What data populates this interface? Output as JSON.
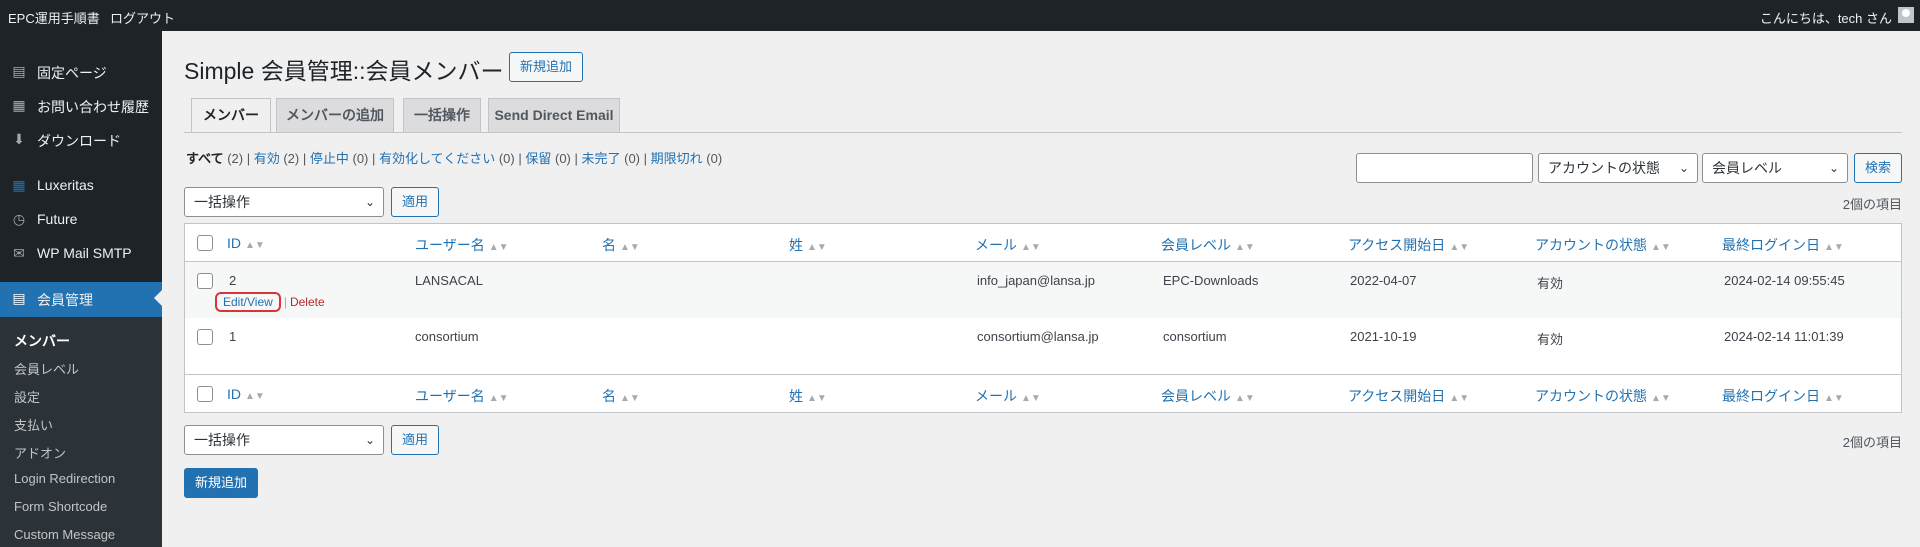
{
  "adminbar": {
    "site_name": "EPC運用手順書",
    "logout": "ログアウト",
    "greeting": "こんにちは、tech さん"
  },
  "sidebar": {
    "items": [
      {
        "label": "固定ページ",
        "icon": "page-icon"
      },
      {
        "label": "お問い合わせ履歴",
        "icon": "inbox-icon"
      },
      {
        "label": "ダウンロード",
        "icon": "download-icon"
      },
      {
        "label": "Luxeritas",
        "icon": "grid-icon"
      },
      {
        "label": "Future",
        "icon": "clock-icon"
      },
      {
        "label": "WP Mail SMTP",
        "icon": "mail-icon"
      },
      {
        "label": "会員管理",
        "icon": "id-card-icon"
      }
    ],
    "submenu": [
      "メンバー",
      "会員レベル",
      "設定",
      "支払い",
      "アドオン",
      "Login Redirection",
      "Form Shortcode",
      "Custom Message"
    ]
  },
  "page": {
    "title": "Simple 会員管理::会員メンバー",
    "add_new": "新規追加"
  },
  "tabs": [
    "メンバー",
    "メンバーの追加",
    "一括操作",
    "Send Direct Email"
  ],
  "filters": {
    "all": "すべて",
    "all_count": "(2)",
    "items": [
      {
        "label": "有効",
        "count": "(2)"
      },
      {
        "label": "停止中",
        "count": "(0)"
      },
      {
        "label": "有効化してください",
        "count": "(0)"
      },
      {
        "label": "保留",
        "count": "(0)"
      },
      {
        "label": "未完了",
        "count": "(0)"
      },
      {
        "label": "期限切れ",
        "count": "(0)"
      }
    ]
  },
  "search": {
    "placeholder": "",
    "status_select": "アカウントの状態",
    "level_select": "会員レベル",
    "button": "検索"
  },
  "bulk": {
    "select": "一括操作",
    "apply": "適用",
    "item_count": "2個の項目"
  },
  "columns": [
    "ID",
    "ユーザー名",
    "名",
    "姓",
    "メール",
    "会員レベル",
    "アクセス開始日",
    "アカウントの状態",
    "最終ログイン日"
  ],
  "rows": [
    {
      "id": "2",
      "username": "LANSACAL",
      "first": "",
      "last": "",
      "email": "info_japan@lansa.jp",
      "level": "EPC-Downloads",
      "start": "2022-04-07",
      "status": "有効",
      "last_login": "2024-02-14 09:55:45"
    },
    {
      "id": "1",
      "username": "consortium",
      "first": "",
      "last": "",
      "email": "consortium@lansa.jp",
      "level": "consortium",
      "start": "2021-10-19",
      "status": "有効",
      "last_login": "2024-02-14 11:01:39"
    }
  ],
  "row_actions": {
    "edit": "Edit/View",
    "delete": "Delete"
  },
  "footer_add_new": "新規追加",
  "colors": {
    "admin_dark": "#1d2327",
    "accent": "#2271b1",
    "highlight": "#d63638"
  }
}
